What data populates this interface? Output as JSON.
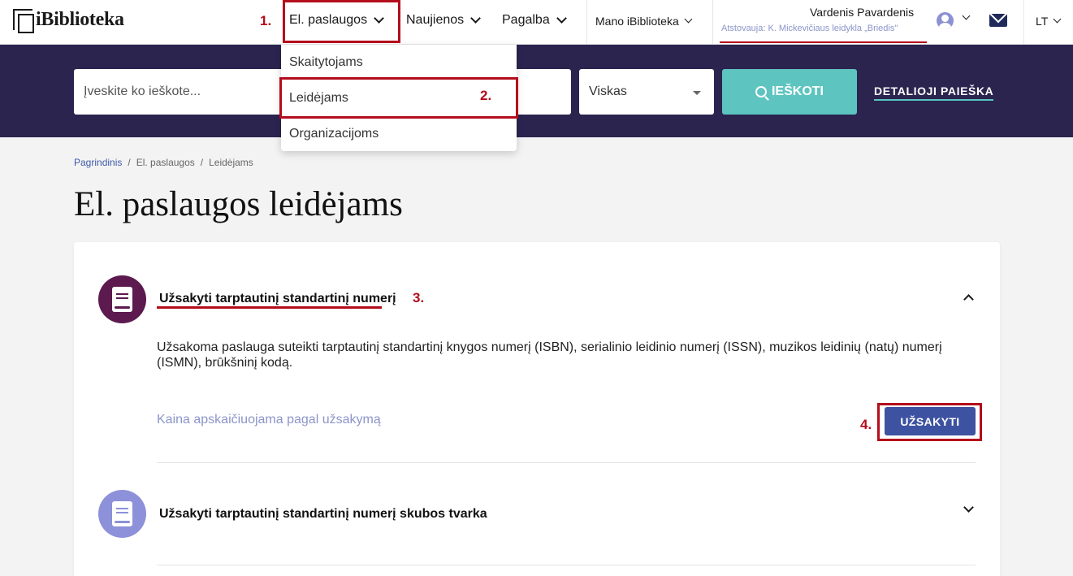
{
  "header": {
    "logo_text": "iBiblioteka",
    "nav": [
      {
        "label": "El. paslaugos"
      },
      {
        "label": "Naujienos"
      },
      {
        "label": "Pagalba"
      },
      {
        "label": "Mano iBiblioteka"
      }
    ],
    "user_name": "Vardenis Pavardenis",
    "represents": "Atstovauja: K. Mickevičiaus leidykla „Briedis\"",
    "language": "LT"
  },
  "search": {
    "placeholder": "Įveskite ko ieškote...",
    "scope_value": "Viskas",
    "button_label": "IEŠKOTI",
    "advanced_label": "DETALIOJI PAIEŠKA"
  },
  "dropdown": {
    "items": [
      {
        "label": "Skaitytojams"
      },
      {
        "label": "Leidėjams"
      },
      {
        "label": "Organizacijoms"
      }
    ]
  },
  "breadcrumbs": [
    "Pagrindinis",
    "El. paslaugos",
    "Leidėjams"
  ],
  "page_title": "El. paslaugos leidėjams",
  "services": [
    {
      "title": "Užsakyti tarptautinį standartinį numerį",
      "description": "Užsakoma paslauga suteikti tarptautinį standartinį knygos numerį (ISBN), serialinio leidinio numerį (ISSN), muzikos leidinių (natų) numerį (ISMN), brūkšninį kodą.",
      "price_note": "Kaina apskaičiuojama pagal užsakymą",
      "order_label": "UŽSAKYTI",
      "icon_color": "#5c1a4e"
    },
    {
      "title": "Užsakyti tarptautinį standartinį numerį skubos tvarka",
      "icon_color": "#8c91d9"
    }
  ],
  "annotations": [
    "1.",
    "2.",
    "3.",
    "4."
  ],
  "colors": {
    "band": "#2b244f",
    "accent": "#5ec4c0",
    "primary_button": "#3d52a0",
    "annotation": "#b40d1c"
  }
}
